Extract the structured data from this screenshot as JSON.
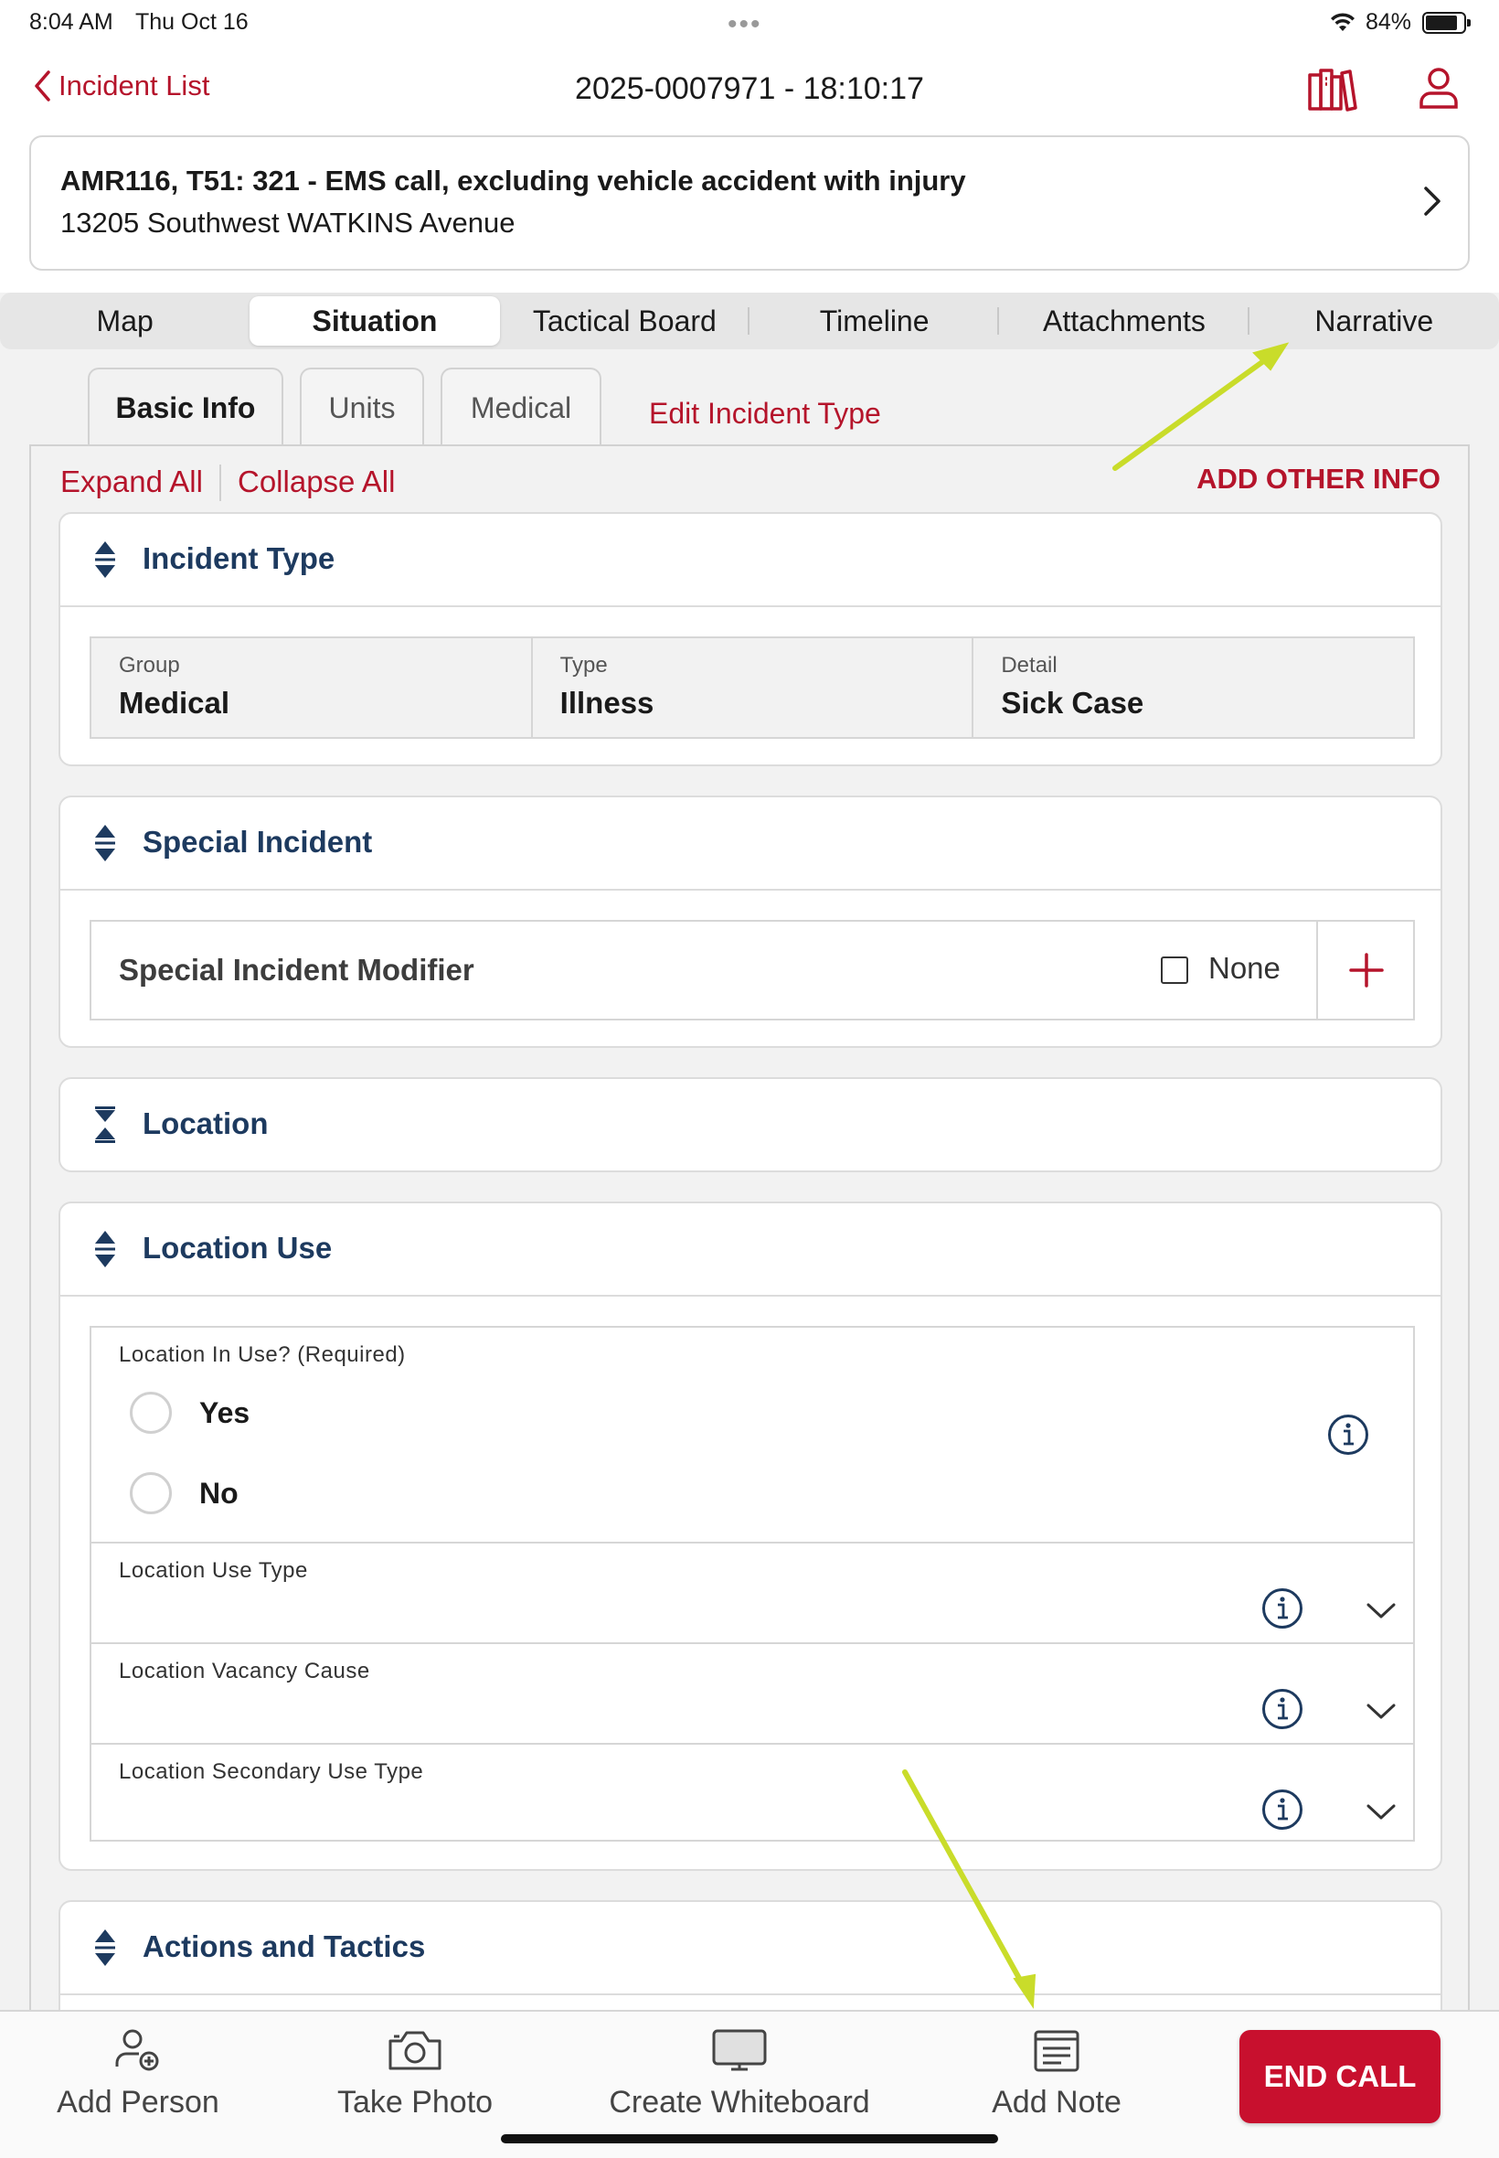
{
  "status_bar": {
    "time": "8:04 AM",
    "date": "Thu Oct 16",
    "battery": "84%",
    "battery_level": 0.84
  },
  "nav": {
    "back_label": "Incident List",
    "title": "2025-0007971 - 18:10:17"
  },
  "incident": {
    "summary": "AMR116, T51: 321 - EMS call, excluding vehicle accident with injury",
    "address": "13205 Southwest WATKINS Avenue"
  },
  "tabs": [
    {
      "label": "Map",
      "active": false
    },
    {
      "label": "Situation",
      "active": true
    },
    {
      "label": "Tactical Board",
      "active": false
    },
    {
      "label": "Timeline",
      "active": false
    },
    {
      "label": "Attachments",
      "active": false
    },
    {
      "label": "Narrative",
      "active": false
    }
  ],
  "subtabs": [
    {
      "label": "Basic Info",
      "active": true
    },
    {
      "label": "Units",
      "active": false
    },
    {
      "label": "Medical",
      "active": false
    }
  ],
  "edit_incident_type": "Edit Incident Type",
  "expand_all": "Expand All",
  "collapse_all": "Collapse All",
  "add_other_info": "ADD OTHER INFO",
  "sections": {
    "incident_type": {
      "title": "Incident Type",
      "fields": [
        {
          "label": "Group",
          "value": "Medical"
        },
        {
          "label": "Type",
          "value": "Illness"
        },
        {
          "label": "Detail",
          "value": "Sick Case"
        }
      ]
    },
    "special_incident": {
      "title": "Special Incident",
      "modifier_label": "Special Incident Modifier",
      "none_label": "None",
      "none_checked": false
    },
    "location": {
      "title": "Location"
    },
    "location_use": {
      "title": "Location Use",
      "question": "Location In Use? (Required)",
      "options": [
        "Yes",
        "No"
      ],
      "dropdowns": [
        {
          "label": "Location Use Type",
          "value": ""
        },
        {
          "label": "Location Vacancy Cause",
          "value": ""
        },
        {
          "label": "Location Secondary Use Type",
          "value": ""
        }
      ]
    },
    "actions_tactics": {
      "title": "Actions and Tactics"
    }
  },
  "toolbar": {
    "add_person": "Add Person",
    "take_photo": "Take Photo",
    "create_whiteboard": "Create Whiteboard",
    "add_note": "Add Note",
    "end_call": "END CALL"
  },
  "colors": {
    "accent_red": "#b5142b",
    "end_call_red": "#c8102e",
    "section_title_navy": "#1d3a5f",
    "annotation_arrow": "#c9dc2a"
  },
  "icons": [
    "chevron-left-icon",
    "library-icon",
    "user-icon",
    "chevron-right-icon",
    "sort-icon",
    "collapse-icon",
    "plus-icon",
    "info-icon",
    "chevron-down-icon",
    "add-person-icon",
    "camera-icon",
    "monitor-icon",
    "note-icon",
    "wifi-icon",
    "battery-icon"
  ]
}
